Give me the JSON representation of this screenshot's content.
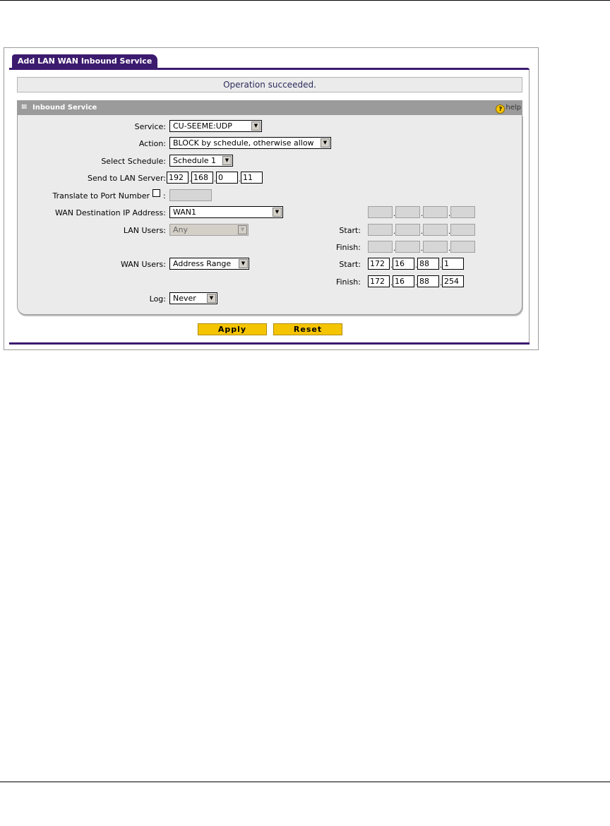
{
  "tab": {
    "label": "Add LAN WAN Inbound Service"
  },
  "status_message": "Operation succeeded.",
  "section": {
    "title": "Inbound Service",
    "help_label": "help"
  },
  "form": {
    "service": {
      "label": "Service:",
      "value": "CU-SEEME:UDP"
    },
    "action": {
      "label": "Action:",
      "value": "BLOCK by schedule, otherwise allow"
    },
    "schedule": {
      "label": "Select Schedule:",
      "value": "Schedule 1"
    },
    "send_to_lan": {
      "label": "Send to LAN Server:",
      "ip": [
        "192",
        "168",
        "0",
        "11"
      ]
    },
    "translate": {
      "label": "Translate to Port Number",
      "colon": ":",
      "checked": false,
      "value": ""
    },
    "wan_dest": {
      "label": "WAN Destination IP Address:",
      "value": "WAN1",
      "ip": [
        "",
        "",
        "",
        ""
      ]
    },
    "lan_users": {
      "label": "LAN Users:",
      "value": "Any",
      "start_label": "Start:",
      "finish_label": "Finish:",
      "start_ip": [
        "",
        "",
        "",
        ""
      ],
      "finish_ip": [
        "",
        "",
        "",
        ""
      ]
    },
    "wan_users": {
      "label": "WAN Users:",
      "value": "Address Range",
      "start_label": "Start:",
      "finish_label": "Finish:",
      "start_ip": [
        "172",
        "16",
        "88",
        "1"
      ],
      "finish_ip": [
        "172",
        "16",
        "88",
        "254"
      ]
    },
    "log": {
      "label": "Log:",
      "value": "Never"
    }
  },
  "buttons": {
    "apply": "Apply",
    "reset": "Reset"
  },
  "colors": {
    "brand": "#3c1b6e",
    "button": "#f5c400",
    "panel": "#ebebeb",
    "header": "#9b9b9b"
  }
}
